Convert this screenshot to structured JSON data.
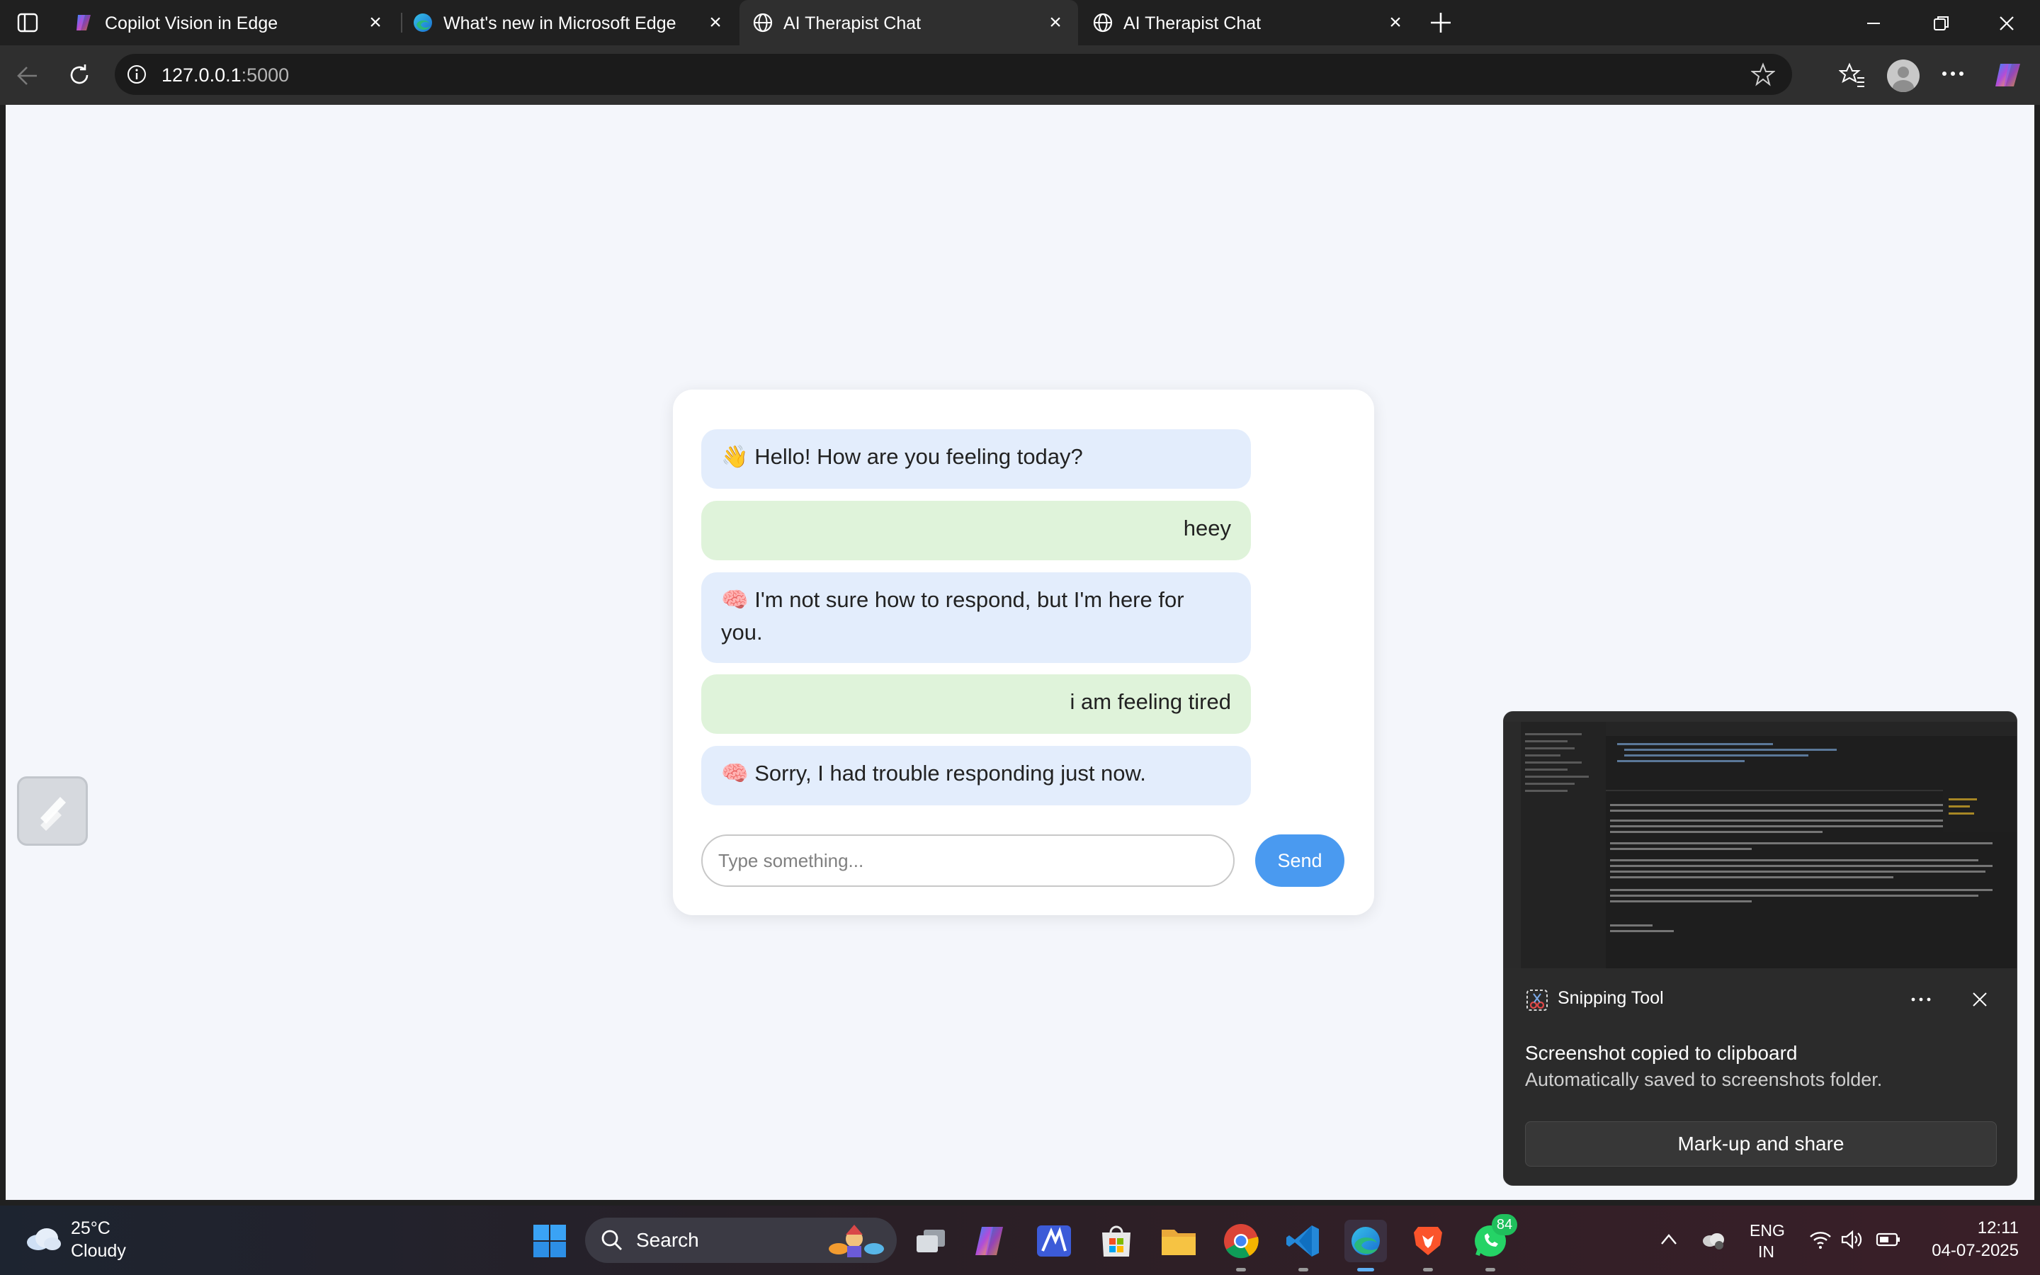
{
  "browser": {
    "tabs": [
      {
        "label": "Copilot Vision in Edge",
        "favicon": "copilot-icon"
      },
      {
        "label": "What's new in Microsoft Edge",
        "favicon": "edge-icon"
      },
      {
        "label": "AI Therapist Chat",
        "favicon": "globe-icon"
      },
      {
        "label": "AI Therapist Chat",
        "favicon": "globe-icon"
      }
    ],
    "active_tab": 2,
    "url_host": "127.0.0.1",
    "url_port": ":5000"
  },
  "chat": {
    "messages": [
      {
        "role": "bot",
        "emoji": "👋",
        "text": "Hello! How are you feeling today?"
      },
      {
        "role": "user",
        "text": "heey"
      },
      {
        "role": "bot",
        "emoji": "🧠",
        "text": "I'm not sure how to respond, but I'm here for you."
      },
      {
        "role": "user",
        "text": "i am feeling tired"
      },
      {
        "role": "bot",
        "emoji": "🧠",
        "text": "Sorry, I had trouble responding just now."
      }
    ],
    "input_placeholder": "Type something...",
    "send_label": "Send",
    "colors": {
      "bot_bubble": "#e3edfc",
      "user_bubble": "#dff3da",
      "send_button": "#4a9af0"
    }
  },
  "toast": {
    "app_name": "Snipping Tool",
    "message": "Screenshot copied to clipboard",
    "submessage": "Automatically saved to screenshots folder.",
    "button_label": "Mark-up and share"
  },
  "taskbar": {
    "weather": {
      "temp": "25°C",
      "condition": "Cloudy"
    },
    "search_label": "Search",
    "whatsapp_badge": "84",
    "language": {
      "line1": "ENG",
      "line2": "IN"
    },
    "clock": {
      "time": "12:11",
      "date": "04-07-2025"
    }
  }
}
